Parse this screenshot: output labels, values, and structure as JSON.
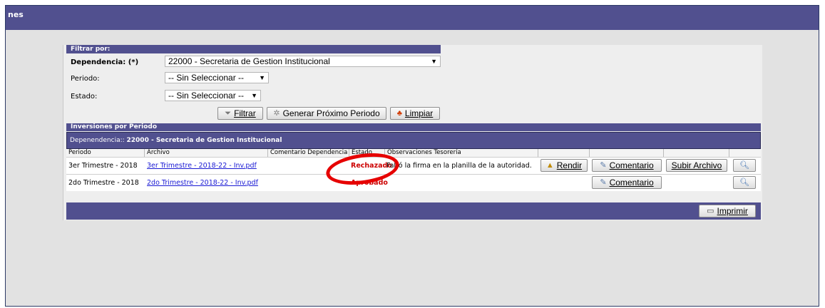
{
  "topbar": {
    "title": "nes"
  },
  "filter": {
    "header": "Filtrar por:",
    "dependencia_label": "Dependencia: (*)",
    "dependencia_value": "22000 - Secretaria de Gestion Institucional",
    "periodo_label": "Periodo:",
    "periodo_value": "-- Sin Seleccionar --",
    "estado_label": "Estado:",
    "estado_value": "-- Sin Seleccionar --",
    "buttons": {
      "filtrar": "Filtrar",
      "generar": "Generar Próximo Periodo",
      "limpiar": "Limpiar"
    }
  },
  "inversiones": {
    "header": "Inversiones por Periodo",
    "dep_prefix": "Depenendencia:: ",
    "dep_name": "22000 - Secretaria de Gestion Institucional",
    "columns": [
      "Periodo",
      "Archivo",
      "Comentario Dependencia",
      "Estado",
      "Observaciones Tesorería"
    ],
    "rows": [
      {
        "periodo": "3er Trimestre - 2018",
        "archivo": "3er Trimestre - 2018-22 - Inv.pdf",
        "estado": "Rechazado",
        "observacion": "Faltó la firma en la planilla de la autoridad.",
        "btn_rendir": "Rendir",
        "btn_comentario": "Comentario",
        "btn_subir": "Subir Archivo"
      },
      {
        "periodo": "2do Trimestre - 2018",
        "archivo": "2do Trimestre - 2018-22 - Inv.pdf",
        "estado": "Aprobado",
        "btn_comentario": "Comentario"
      }
    ],
    "imprimir": "Imprimir"
  },
  "colors": {
    "header": "#51508f",
    "estado": "#cc0000",
    "highlight": "#e60000"
  },
  "icons": [
    "funnel-icon",
    "gear-icon",
    "broom-icon",
    "stamp-icon",
    "pencil-icon",
    "magnifier-icon",
    "printer-icon"
  ]
}
